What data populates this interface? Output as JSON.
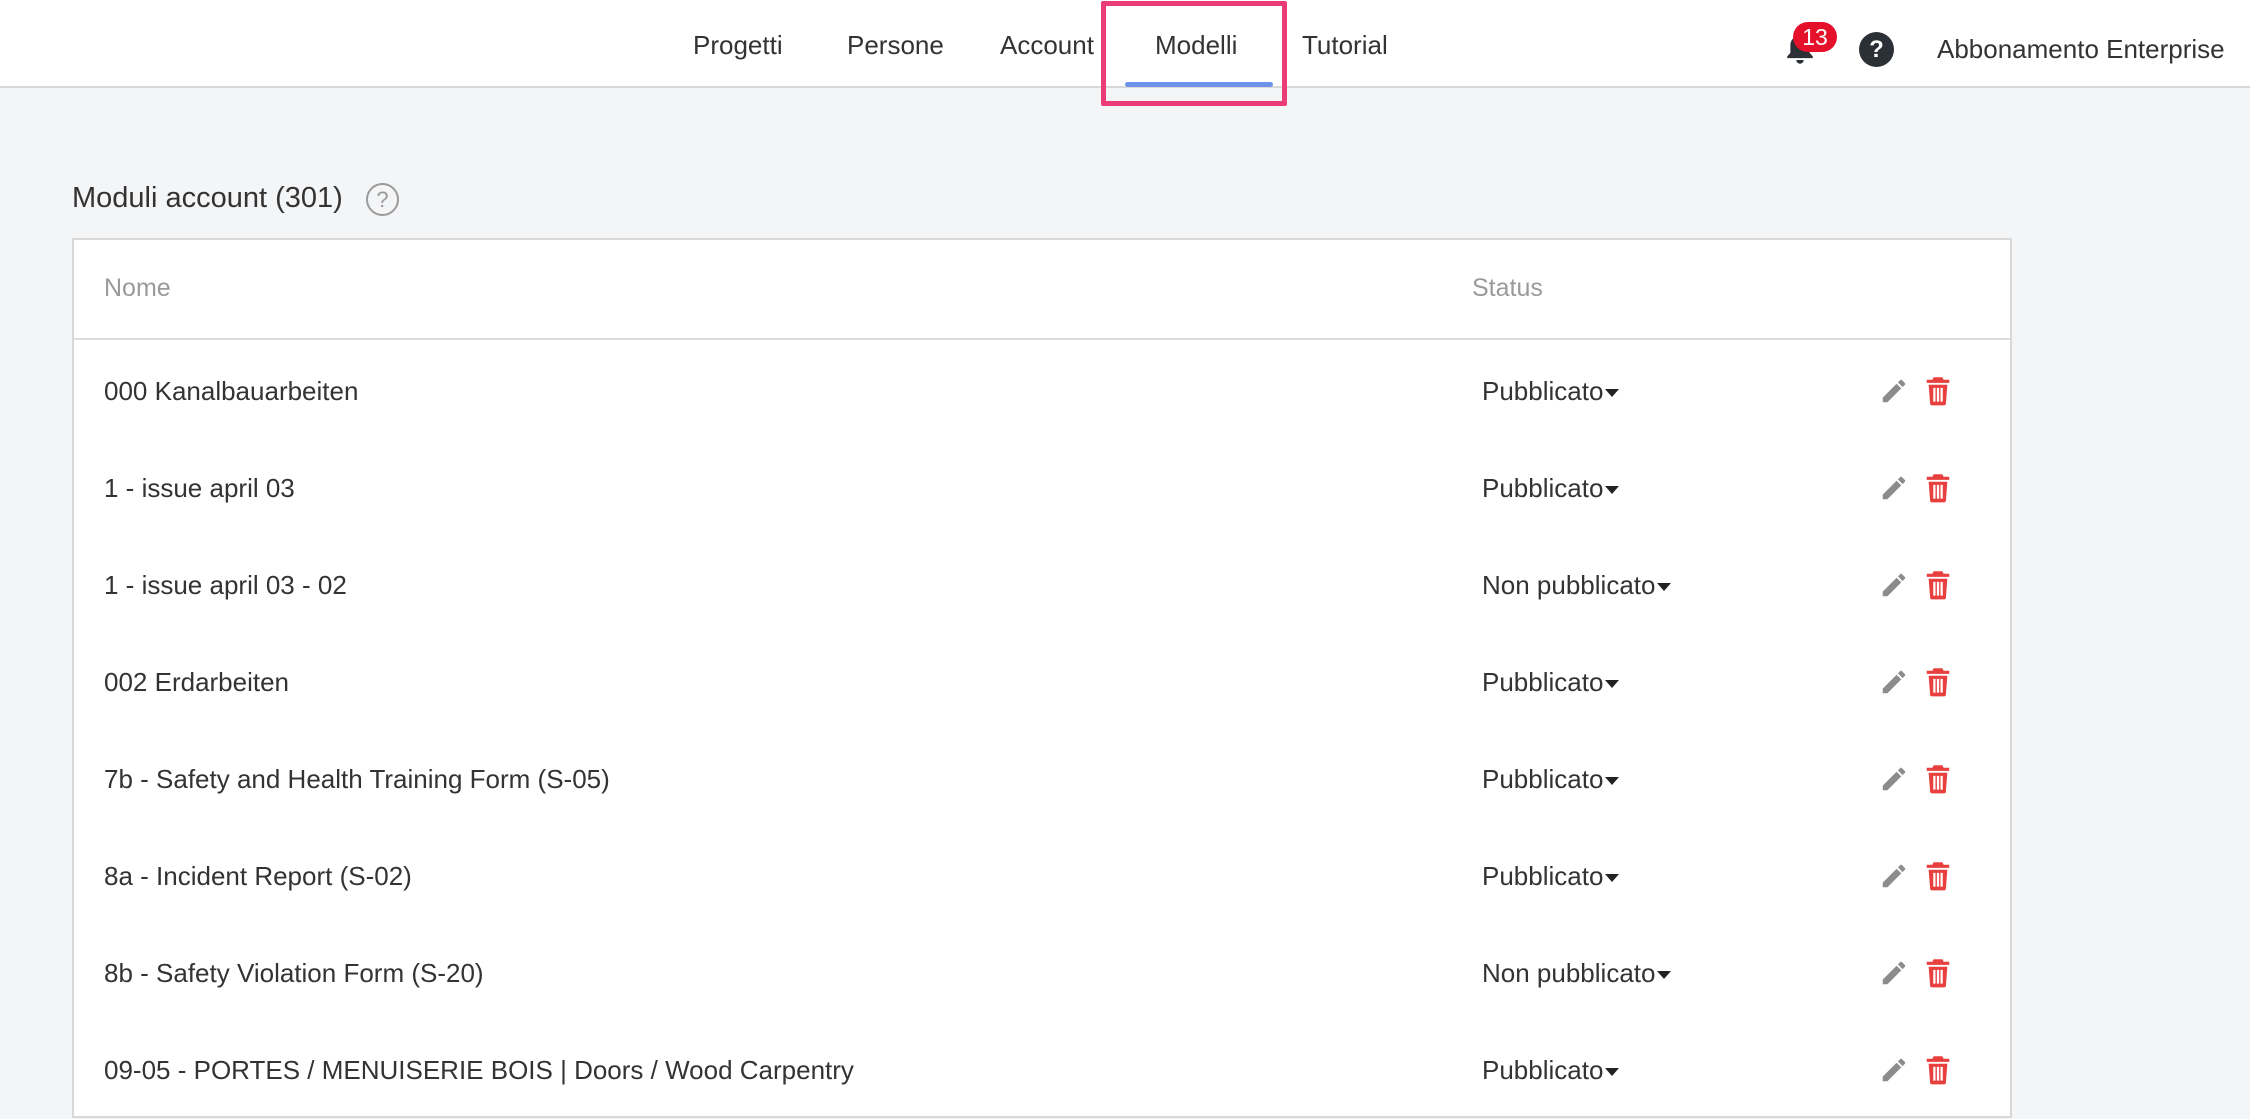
{
  "nav": {
    "tabs": [
      {
        "label": "Progetti"
      },
      {
        "label": "Persone"
      },
      {
        "label": "Account"
      },
      {
        "label": "Modelli"
      },
      {
        "label": "Tutorial"
      }
    ],
    "active_tab": "Modelli",
    "notifications_count": "13",
    "help_glyph": "?",
    "plan_label": "Abbonamento Enterprise"
  },
  "section": {
    "title": "Moduli account (301)",
    "help_glyph": "?"
  },
  "table": {
    "columns": [
      "Nome",
      "Status"
    ],
    "rows": [
      {
        "name": "000 Kanalbauarbeiten",
        "status": "Pubblicato"
      },
      {
        "name": "1 - issue april 03",
        "status": "Pubblicato"
      },
      {
        "name": "1 - issue april 03 - 02",
        "status": "Non pubblicato"
      },
      {
        "name": "002 Erdarbeiten",
        "status": "Pubblicato"
      },
      {
        "name": "7b - Safety and Health Training Form (S-05)",
        "status": "Pubblicato"
      },
      {
        "name": "8a - Incident Report (S-02)",
        "status": "Pubblicato"
      },
      {
        "name": "8b - Safety Violation Form (S-20)",
        "status": "Non pubblicato"
      },
      {
        "name": "09-05 - PORTES / MENUISERIE BOIS | Doors / Wood Carpentry",
        "status": "Pubblicato"
      }
    ]
  },
  "icons": {
    "bell": "bell-icon",
    "help": "question-circle-icon",
    "edit": "pencil-icon",
    "delete": "trash-icon",
    "dropdown": "caret-down-icon"
  },
  "colors": {
    "accent_underline": "#6d93e9",
    "highlight_box": "#ea3c75",
    "badge": "#e5102a",
    "trash": "#e8403f",
    "edit": "#8c8c8c",
    "background": "#f4f5f7"
  }
}
